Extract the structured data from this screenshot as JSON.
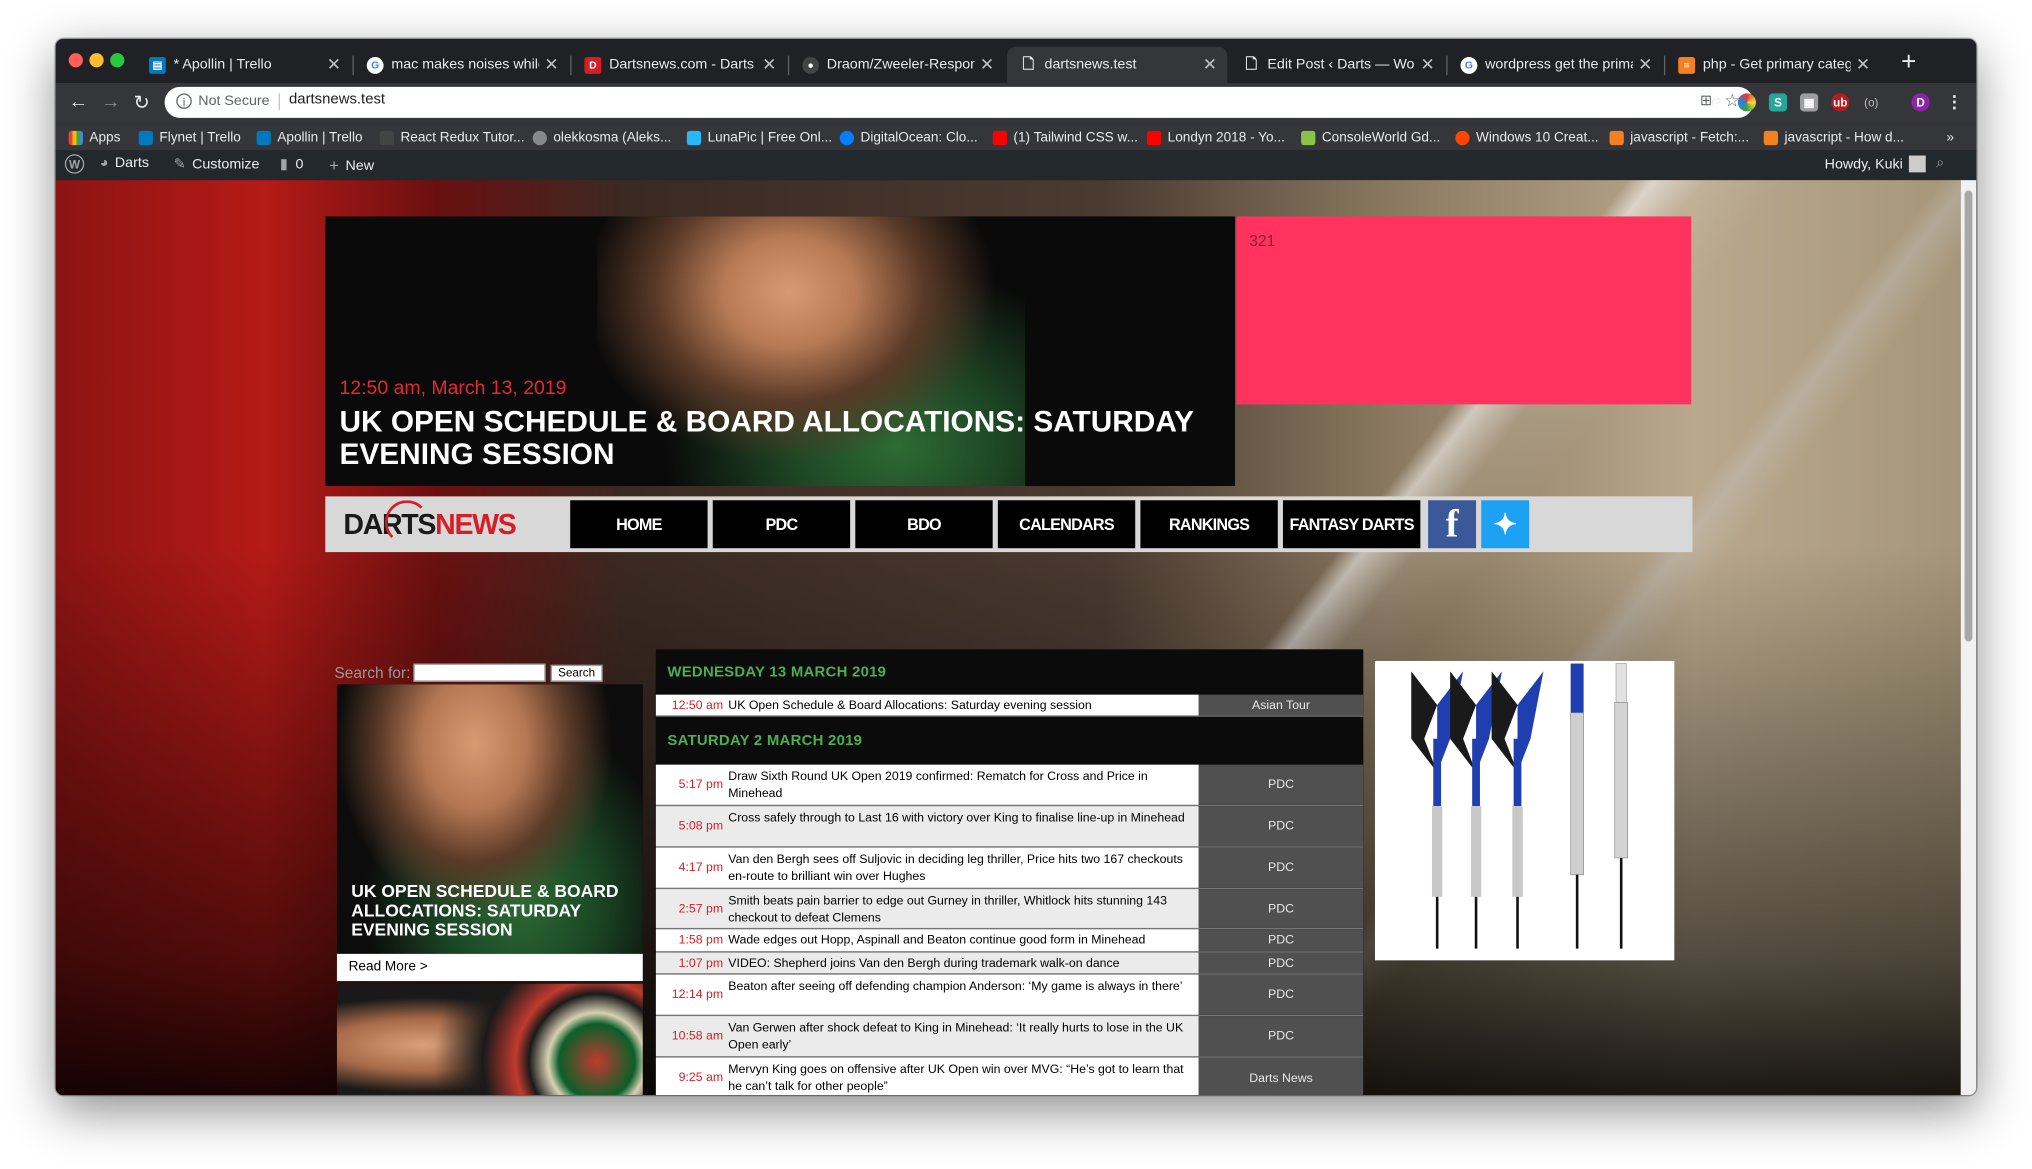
{
  "browser": {
    "tabs": [
      {
        "title": "* Apollin | Trello",
        "active": false
      },
      {
        "title": "mac makes noises while mo",
        "active": false
      },
      {
        "title": "Dartsnews.com - Darts - La",
        "active": false
      },
      {
        "title": "Draom/Zweeler-Responsive",
        "active": false
      },
      {
        "title": "dartsnews.test",
        "active": true
      },
      {
        "title": "Edit Post ‹ Darts — WordPr",
        "active": false
      },
      {
        "title": "wordpress get the primary c",
        "active": false
      },
      {
        "title": "php - Get primary category",
        "active": false
      }
    ],
    "security_label": "Not Secure",
    "url": "dartsnews.test",
    "profile_initial": "D",
    "bookmarks": [
      "Apps",
      "Flynet | Trello",
      "Apollin | Trello",
      "React Redux Tutor...",
      "olekkosma (Aleks...",
      "LunaPic | Free Onl...",
      "DigitalOcean: Clo...",
      "(1) Tailwind CSS w...",
      "Londyn 2018 - Yo...",
      "ConsoleWorld Gd...",
      "Windows 10 Creat...",
      "javascript - Fetch:...",
      "javascript - How d..."
    ],
    "bookmarks_more": "»"
  },
  "wp_admin_bar": {
    "site_name": "Darts",
    "customize": "Customize",
    "comments_count": "0",
    "new_label": "New",
    "greeting": "Howdy, Kuki"
  },
  "hero": {
    "date": "12:50 am, March 13, 2019",
    "title": "UK OPEN SCHEDULE & BOARD ALLOCATIONS: SATURDAY EVENING SESSION"
  },
  "ad_box": {
    "label": "321"
  },
  "logo": {
    "part1": "DARTS",
    "part2": "NEWS"
  },
  "nav": {
    "items": [
      "HOME",
      "PDC",
      "BDO",
      "CALENDARS",
      "RANKINGS",
      "FANTASY DARTS"
    ]
  },
  "search": {
    "label": "Search for:",
    "button": "Search"
  },
  "featured_card": {
    "title": "UK OPEN SCHEDULE & BOARD ALLOCATIONS: SATURDAY EVENING SESSION",
    "read_more": "Read More >"
  },
  "schedule": {
    "days": [
      {
        "heading": "WEDNESDAY 13 MARCH 2019",
        "rows": [
          {
            "time": "12:50 am",
            "title": "UK Open Schedule & Board Allocations: Saturday evening session",
            "category": "Asian Tour"
          }
        ]
      },
      {
        "heading": "SATURDAY 2 MARCH 2019",
        "rows": [
          {
            "time": "5:17 pm",
            "title": "Draw Sixth Round UK Open 2019 confirmed: Rematch for Cross and Price in Minehead",
            "category": "PDC"
          },
          {
            "time": "5:08 pm",
            "title": "Cross safely through to Last 16 with victory over King to finalise line-up in Minehead",
            "category": "PDC"
          },
          {
            "time": "4:17 pm",
            "title": "Van den Bergh sees off Suljovic in deciding leg thriller, Price hits two 167 checkouts en-route to brilliant win over Hughes",
            "category": "PDC"
          },
          {
            "time": "2:57 pm",
            "title": "Smith beats pain barrier to edge out Gurney in thriller, Whitlock hits stunning 143 checkout to defeat Clemens",
            "category": "PDC"
          },
          {
            "time": "1:58 pm",
            "title": "Wade edges out Hopp, Aspinall and Beaton continue good form in Minehead",
            "category": "PDC"
          },
          {
            "time": "1:07 pm",
            "title": "VIDEO: Shepherd joins Van den Bergh during trademark walk-on dance",
            "category": "PDC"
          },
          {
            "time": "12:14 pm",
            "title": "Beaton after seeing off defending champion Anderson: ‘My game is always in there’",
            "category": "PDC"
          },
          {
            "time": "10:58 am",
            "title": "Van Gerwen after shock defeat to King in Minehead: ‘It really hurts to lose in the UK Open early’",
            "category": "PDC"
          },
          {
            "time": "9:25 am",
            "title": "Mervyn King goes on offensive after UK Open win over MVG: “He’s got to learn that he can’t talk for other people”",
            "category": "Darts News"
          }
        ]
      }
    ]
  },
  "colors": {
    "accent_red": "#d51f26",
    "pink_box": "#ff335e",
    "day_heading_green": "#4caf50"
  }
}
